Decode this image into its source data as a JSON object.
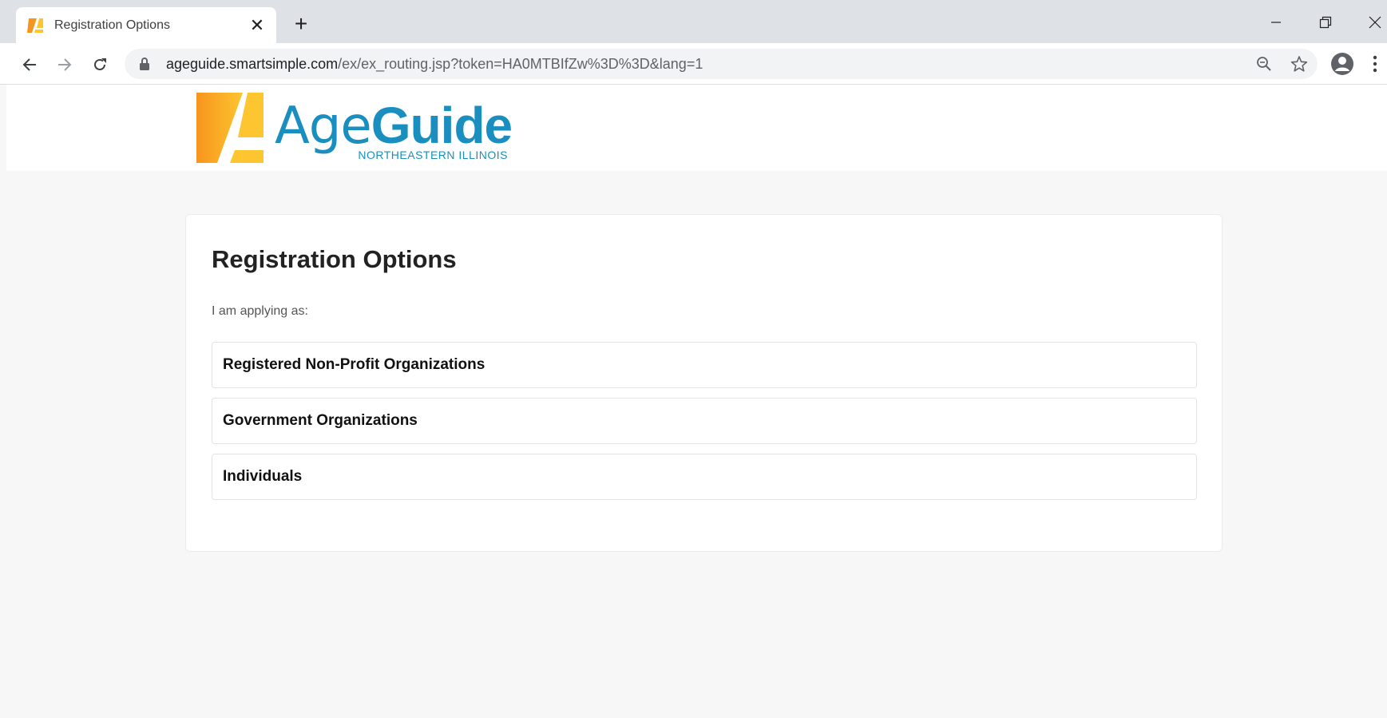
{
  "browser": {
    "tab_title": "Registration Options",
    "tab_close_glyph": "✕",
    "new_tab_glyph": "+",
    "url_host": "ageguide.smartsimple.com",
    "url_path": "/ex/ex_routing.jsp?token=HA0MTBIfZw%3D%3D&lang=1"
  },
  "logo": {
    "age": "Age",
    "guide": "Guide",
    "subtitle": "NORTHEASTERN ILLINOIS",
    "colors": {
      "blue": "#1a8fbf",
      "orange": "#f7941d",
      "yellow": "#fdc52f"
    }
  },
  "main": {
    "title": "Registration Options",
    "subtitle": "I am applying as:",
    "options": [
      {
        "label": "Registered Non-Profit Organizations"
      },
      {
        "label": "Government Organizations"
      },
      {
        "label": "Individuals"
      }
    ]
  }
}
